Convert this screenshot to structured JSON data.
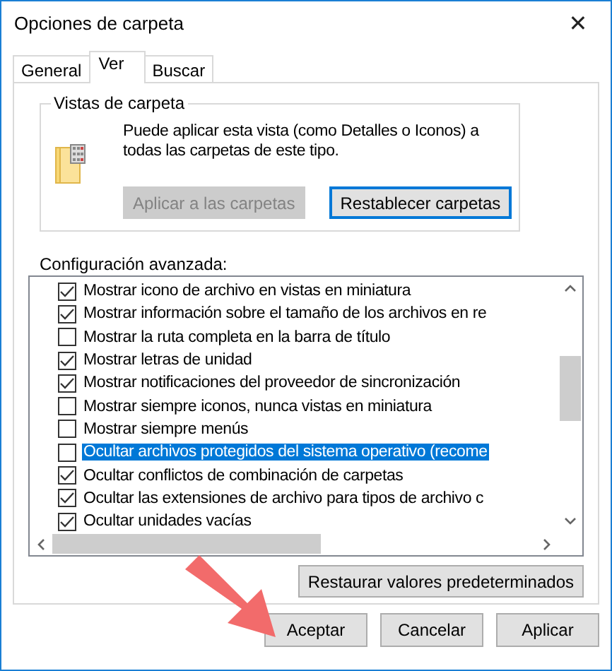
{
  "window": {
    "title": "Opciones de carpeta",
    "close": "✕"
  },
  "tabs": [
    {
      "label": "General",
      "selected": false
    },
    {
      "label": "Ver",
      "selected": true
    },
    {
      "label": "Buscar",
      "selected": false
    }
  ],
  "folder_views": {
    "title": "Vistas de carpeta",
    "description": "Puede aplicar esta vista (como Detalles o Iconos) a todas las carpetas de este tipo.",
    "buttons": [
      {
        "label": "Aplicar a las carpetas",
        "disabled": true,
        "focused": false
      },
      {
        "label": "Restablecer carpetas",
        "disabled": false,
        "focused": true
      }
    ]
  },
  "advanced": {
    "label": "Configuración avanzada:",
    "items": [
      {
        "label": "Mostrar icono de archivo en vistas en miniatura",
        "checked": true,
        "selected": false
      },
      {
        "label": "Mostrar información sobre el tamaño de los archivos en re",
        "checked": true,
        "selected": false
      },
      {
        "label": "Mostrar la ruta completa en la barra de título",
        "checked": false,
        "selected": false
      },
      {
        "label": "Mostrar letras de unidad",
        "checked": true,
        "selected": false
      },
      {
        "label": "Mostrar notificaciones del proveedor de sincronización",
        "checked": true,
        "selected": false
      },
      {
        "label": "Mostrar siempre iconos, nunca vistas en miniatura",
        "checked": false,
        "selected": false
      },
      {
        "label": "Mostrar siempre menús",
        "checked": false,
        "selected": false
      },
      {
        "label": "Ocultar archivos protegidos del sistema operativo (recome",
        "checked": false,
        "selected": true
      },
      {
        "label": "Ocultar conflictos de combinación de carpetas",
        "checked": true,
        "selected": false
      },
      {
        "label": "Ocultar las extensiones de archivo para tipos de archivo c",
        "checked": true,
        "selected": false
      },
      {
        "label": "Ocultar unidades vacías",
        "checked": true,
        "selected": false
      }
    ]
  },
  "restore_button": "Restaurar valores predeterminados",
  "buttons": [
    "Aceptar",
    "Cancelar",
    "Aplicar"
  ]
}
